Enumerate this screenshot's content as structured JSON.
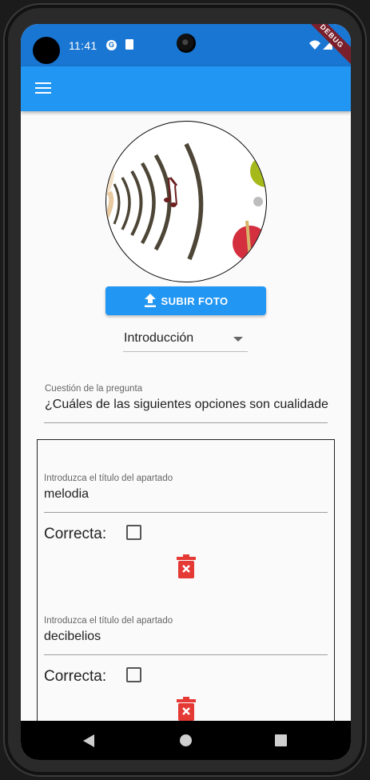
{
  "status_bar": {
    "time": "11:41",
    "debug_banner": "DEBUG",
    "icons": [
      "camera-cutout",
      "app-notification-icon",
      "sd-card-icon",
      "wifi-icon",
      "signal-icon",
      "battery-icon"
    ]
  },
  "app_bar": {
    "menu_icon": "hamburger-menu-icon",
    "color": "#2196f3"
  },
  "main": {
    "photo_icon": "music-illustration",
    "upload_button": "SUBIR FOTO",
    "upload_icon": "upload-icon",
    "dropdown": {
      "value": "Introducción"
    },
    "question": {
      "label": "Cuestión de la pregunta",
      "value": "¿Cuáles de las siguientes opciones son cualidade"
    },
    "options": [
      {
        "label": "Introduzca el título del apartado",
        "value": "melodia",
        "correct_label": "Correcta:",
        "checked": false
      },
      {
        "label": "Introduzca el título del apartado",
        "value": "decibelios",
        "correct_label": "Correcta:",
        "checked": false
      }
    ]
  },
  "nav_bar": {
    "icons": [
      "back-icon",
      "home-icon",
      "recents-icon"
    ]
  },
  "colors": {
    "status_bar": "#1976d2",
    "app_bar": "#2196f3",
    "button": "#2196f3",
    "delete": "#e53935"
  }
}
